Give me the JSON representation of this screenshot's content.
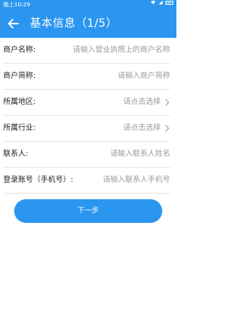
{
  "status_bar": {
    "time": "晚上10:29"
  },
  "header": {
    "title": "基本信息（1/5）"
  },
  "form": {
    "fields": [
      {
        "label": "商户名称:",
        "placeholder": "请输入营业执照上的商户名称"
      },
      {
        "label": "商户简称:",
        "placeholder": "请输入商户简称"
      },
      {
        "label": "所属地区:",
        "placeholder": "请点击选择"
      },
      {
        "label": "所属行业:",
        "placeholder": "请点击选择"
      },
      {
        "label": "联系人:",
        "placeholder": "请输入联系人姓名"
      },
      {
        "label": "登录账号（手机号）:",
        "placeholder": "请输入联系人手机号"
      }
    ]
  },
  "next_button": {
    "label": "下一步"
  },
  "colors": {
    "primary": "#2a96f0",
    "placeholder": "#9a9a9a",
    "divider": "#e6e6e6"
  }
}
